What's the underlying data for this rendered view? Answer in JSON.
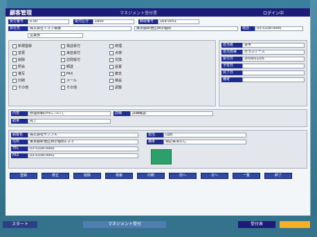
{
  "window": {
    "title": "顧客管理",
    "center_text": "マネジメント受付票",
    "right_text": "ログイン中"
  },
  "header": {
    "fields": [
      {
        "label": "受付番号",
        "value": "0.00"
      },
      {
        "label": "受付区分",
        "value": "1800"
      },
      {
        "label": "郵便番号",
        "value": "169-0051"
      }
    ],
    "company_label": "会社名",
    "company_value": "株式会社リュウ電機",
    "address_value": "東京都新宿区西早稲田",
    "tel_label": "電話",
    "tel_value": "03-5338-0000",
    "dept_value": "営業部"
  },
  "options": {
    "col1": [
      "新規登録",
      "変更",
      "削除",
      "照会",
      "複写",
      "印刷",
      "その他"
    ],
    "col2": [
      "電話受付",
      "来店受付",
      "訪問受付",
      "郵送",
      "FAX",
      "メール",
      "その他"
    ],
    "col3": [
      "修理",
      "点検",
      "交換",
      "設置",
      "撤去",
      "移設",
      "調整"
    ]
  },
  "right_panel": {
    "labels": [
      "担当者",
      "担当部署",
      "受付日",
      "予定日",
      "完了日",
      "備考"
    ],
    "values": [
      "青木",
      "ガラスケース",
      "2009/01/05",
      "",
      "",
      ""
    ]
  },
  "middle_panel": {
    "labels": [
      "内容",
      "詳細",
      "結果"
    ],
    "values": [
      "修理依頼の件について",
      "詳細確認",
      "完了"
    ]
  },
  "lower_panel": {
    "labels": [
      "顧客名",
      "住所",
      "TEL",
      "FAX",
      "担当",
      "備考"
    ],
    "values": [
      "株式会社サンプル",
      "東京都新宿区西早稲田1-2-3",
      "03-5338-0000",
      "03-5338-0001",
      "山田",
      "特記事項なし"
    ]
  },
  "buttons": [
    "登録",
    "修正",
    "削除",
    "検索",
    "印刷",
    "前へ",
    "次へ",
    "一覧",
    "終了"
  ],
  "taskbar": {
    "left_text": "スタート",
    "center_text": "マネジメント受付",
    "active_label": "受付表",
    "right_block_color": "#f5b026"
  },
  "colors": {
    "accent": "#1f2b8f",
    "title_bg": "#1d1b7a",
    "background": "#3c7f9c"
  }
}
